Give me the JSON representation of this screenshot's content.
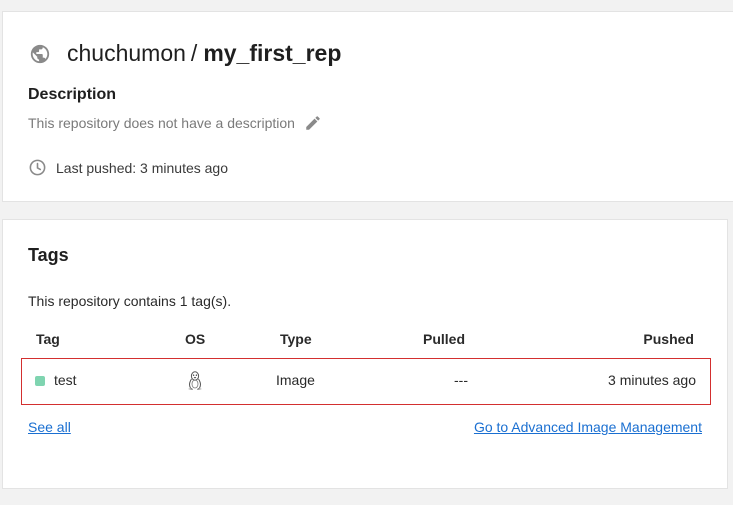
{
  "repo": {
    "owner": "chuchumon",
    "separator": "/",
    "name": "my_first_rep",
    "description_label": "Description",
    "description_text": "This repository does not have a description",
    "last_pushed": "Last pushed: 3 minutes ago",
    "icons": {
      "visibility": "globe-icon",
      "edit": "pencil-icon",
      "time": "clock-icon"
    }
  },
  "tags": {
    "title": "Tags",
    "count_text": "This repository contains 1 tag(s).",
    "columns": [
      "Tag",
      "OS",
      "Type",
      "Pulled",
      "Pushed"
    ],
    "rows": [
      {
        "tag": "test",
        "os_icon": "linux-icon",
        "type": "Image",
        "pulled": "---",
        "pushed": "3 minutes ago"
      }
    ],
    "see_all": "See all",
    "advanced_link": "Go to Advanced Image Management"
  },
  "colors": {
    "link": "#1a6fd1",
    "highlight_border": "#d32f2f",
    "tag_dot": "#7fd4b0"
  }
}
